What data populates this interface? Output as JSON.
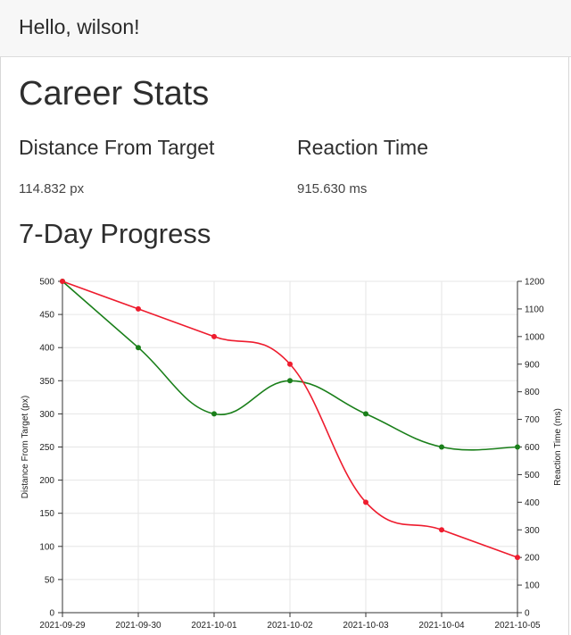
{
  "header": {
    "greeting": "Hello, wilson!"
  },
  "career": {
    "title": "Career Stats",
    "distance_label": "Distance From Target",
    "distance_value": "114.832 px",
    "reaction_label": "Reaction Time",
    "reaction_value": "915.630 ms"
  },
  "progress": {
    "title": "7-Day Progress"
  },
  "chart_data": {
    "type": "line",
    "categories": [
      "2021-09-29",
      "2021-09-30",
      "2021-10-01",
      "2021-10-02",
      "2021-10-03",
      "2021-10-04",
      "2021-10-05"
    ],
    "series": [
      {
        "name": "",
        "axis": "left",
        "color": "#1a7f1a",
        "values": [
          500,
          400,
          300,
          350,
          300,
          250,
          250
        ]
      },
      {
        "name": "",
        "axis": "right",
        "color": "#ee1c2e",
        "values": [
          1200,
          1100,
          1000,
          900,
          400,
          300,
          200
        ]
      }
    ],
    "ylabel": "Distance From Target (px)",
    "y2label": "Reaction Time (ms)",
    "ylim": [
      0,
      500
    ],
    "y2lim": [
      0,
      1200
    ],
    "yticks": [
      0,
      50,
      100,
      150,
      200,
      250,
      300,
      350,
      400,
      450,
      500
    ],
    "y2ticks": [
      0,
      100,
      200,
      300,
      400,
      500,
      600,
      700,
      800,
      900,
      1000,
      1100,
      1200
    ],
    "grid": true
  }
}
